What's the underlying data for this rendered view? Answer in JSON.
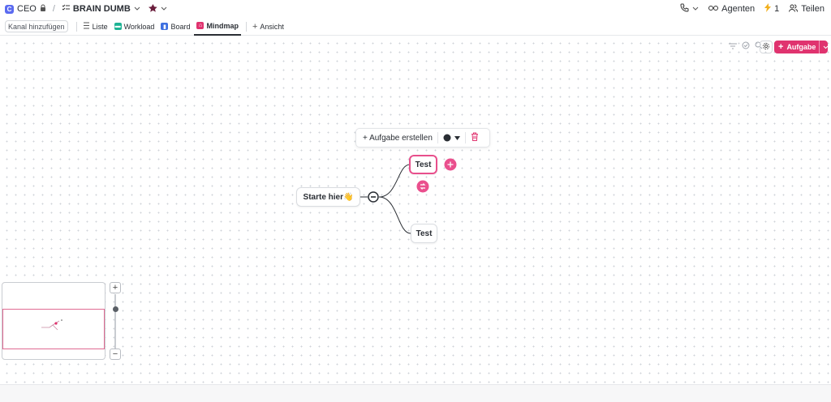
{
  "breadcrumb": {
    "workspace_initial": "C",
    "workspace": "CEO",
    "separator": "/",
    "list_name": "BRAIN DUMB"
  },
  "topright": {
    "agents_label": "Agenten",
    "bolt_count": "1",
    "share_label": "Teilen"
  },
  "tabs": {
    "add_channel": "Kanal hinzufügen",
    "items": [
      {
        "label": "Liste",
        "icon": "list-icon"
      },
      {
        "label": "Workload",
        "icon": "workload-icon"
      },
      {
        "label": "Board",
        "icon": "board-icon"
      },
      {
        "label": "Mindmap",
        "icon": "mindmap-icon"
      }
    ],
    "add_view": "Ansicht"
  },
  "toolbar": {
    "task_button": "Aufgabe"
  },
  "node_toolbar": {
    "create_task": "+ Aufgabe erstellen"
  },
  "mindmap": {
    "root": "Starte hier👋",
    "children": [
      "Test",
      "Test"
    ]
  },
  "colors": {
    "accent": "#e0336f",
    "selected": "#e84f8c"
  }
}
